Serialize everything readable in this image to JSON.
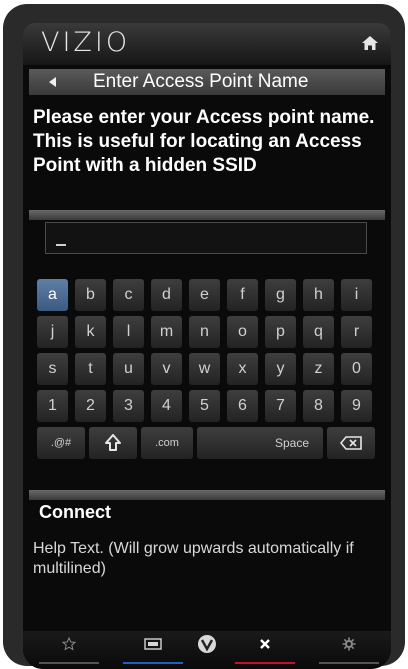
{
  "topbar": {
    "logo": "VIZIO"
  },
  "header": {
    "title": "Enter Access Point Name"
  },
  "prompt": {
    "text": "Please enter your Access point name. This is useful for locating an Access Point with a hidden SSID"
  },
  "input": {
    "value": ""
  },
  "keyboard": {
    "rows": [
      [
        "a",
        "b",
        "c",
        "d",
        "e",
        "f",
        "g",
        "h",
        "i"
      ],
      [
        "j",
        "k",
        "l",
        "m",
        "n",
        "o",
        "p",
        "q",
        "r"
      ],
      [
        "s",
        "t",
        "u",
        "v",
        "w",
        "x",
        "y",
        "z",
        "0"
      ],
      [
        "1",
        "2",
        "3",
        "4",
        "5",
        "6",
        "7",
        "8",
        "9"
      ]
    ],
    "selected": "a",
    "special": {
      "symbols": ".@#",
      "com": ".com",
      "space": "Space"
    }
  },
  "connect": {
    "label": "Connect"
  },
  "help": {
    "text": "Help Text. (Will grow upwards automatically if multilined)"
  },
  "colors": {
    "accent_blue": "#1f5fc8",
    "accent_red": "#c8102e",
    "selected_key": "#4a6a92"
  }
}
